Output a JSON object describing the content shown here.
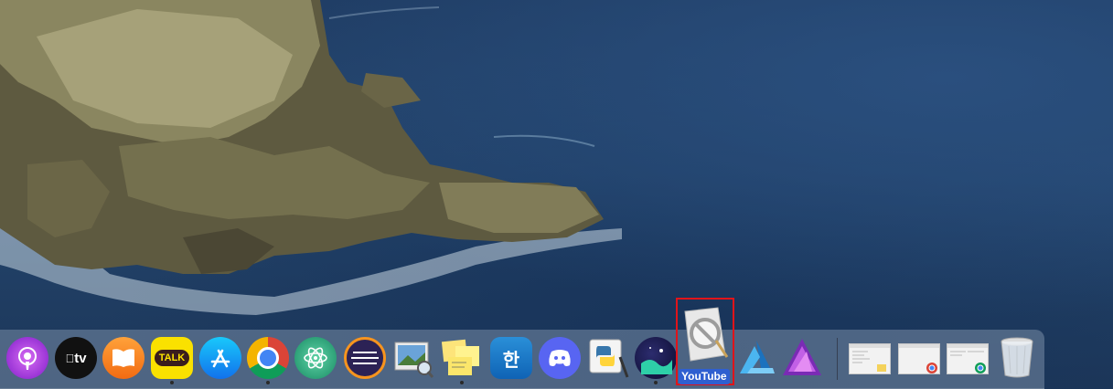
{
  "dock": {
    "items": [
      {
        "id": "podcasts",
        "icon": "podcasts-icon",
        "running": false
      },
      {
        "id": "apple-tv",
        "icon": "apple-tv-icon",
        "label": "tv",
        "running": false
      },
      {
        "id": "books",
        "icon": "books-icon",
        "running": false
      },
      {
        "id": "kakaotalk",
        "icon": "kakaotalk-icon",
        "label": "TALK",
        "running": true
      },
      {
        "id": "app-store",
        "icon": "app-store-icon",
        "running": false
      },
      {
        "id": "chrome",
        "icon": "chrome-icon",
        "running": true
      },
      {
        "id": "atom",
        "icon": "atom-icon",
        "running": false
      },
      {
        "id": "eclipse",
        "icon": "eclipse-icon",
        "running": false
      },
      {
        "id": "preview",
        "icon": "preview-icon",
        "running": false
      },
      {
        "id": "stickies",
        "icon": "stickies-icon",
        "running": true
      },
      {
        "id": "hangul",
        "icon": "hangul-icon",
        "label": "한",
        "running": false
      },
      {
        "id": "discord",
        "icon": "discord-icon",
        "running": false
      },
      {
        "id": "python-launcher",
        "icon": "python-icon",
        "running": false
      },
      {
        "id": "elytra",
        "icon": "moon-app-icon",
        "running": true
      },
      {
        "id": "affinity-designer",
        "icon": "affinity-designer-icon",
        "running": false
      },
      {
        "id": "affinity-photo",
        "icon": "affinity-photo-icon",
        "running": false
      }
    ],
    "dragged_item": {
      "label": "YouTube",
      "icon": "prohibited-app-icon"
    },
    "minimized_windows": [
      {
        "id": "window-1",
        "icon": "window-thumbnail-icon"
      },
      {
        "id": "window-2",
        "icon": "chrome-window-thumbnail-icon"
      },
      {
        "id": "window-3",
        "icon": "chrome-window-thumbnail-icon"
      }
    ],
    "trash": {
      "icon": "trash-icon"
    }
  },
  "colors": {
    "highlight": "#e0141a",
    "label_bg": "#2f5fd0"
  }
}
